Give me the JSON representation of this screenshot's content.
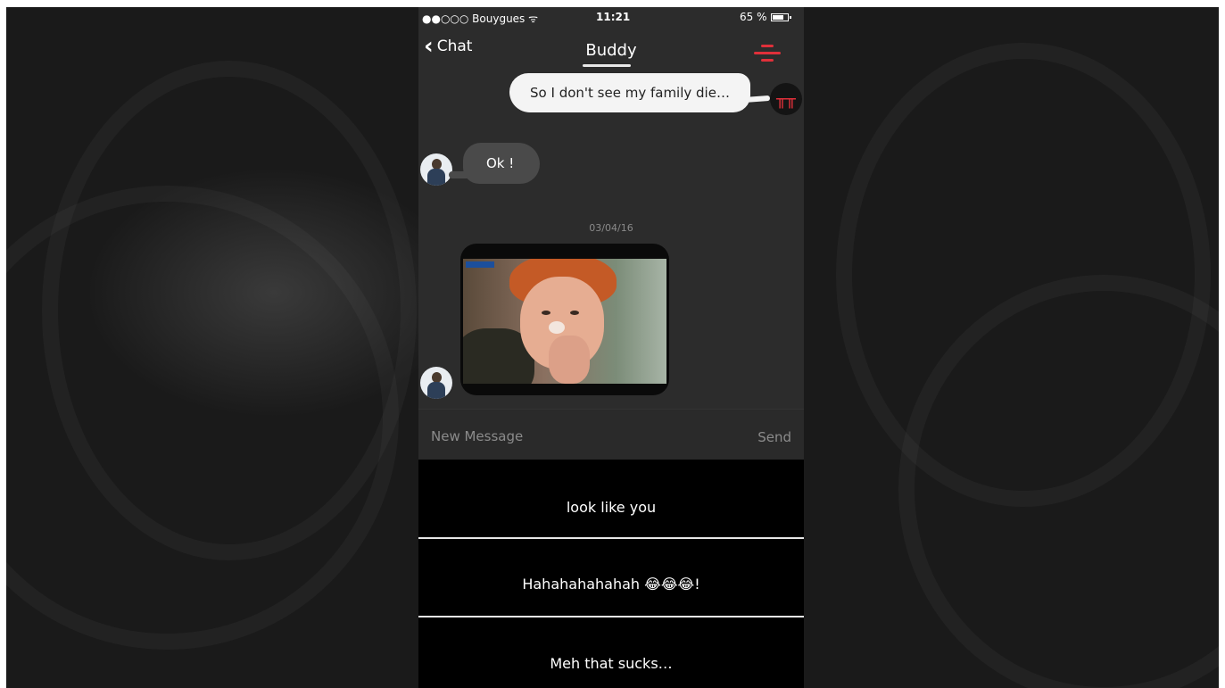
{
  "status_bar": {
    "carrier": "●●○○○ Bouygues ᯤ",
    "time": "11:21",
    "battery": "65 %"
  },
  "nav": {
    "back_label": "Chat",
    "title": "Buddy",
    "accent_color": "#e0303a"
  },
  "messages": {
    "outgoing_text": "So I don't see my family die…",
    "my_avatar_glyph": "╥╥",
    "incoming_text": "Ok !",
    "date_separator": "03/04/16"
  },
  "composer": {
    "placeholder": "New Message",
    "send_label": "Send"
  },
  "suggestions": [
    "look like you",
    "Hahahahahahah 😂😂😂!",
    "Meh that sucks…"
  ]
}
